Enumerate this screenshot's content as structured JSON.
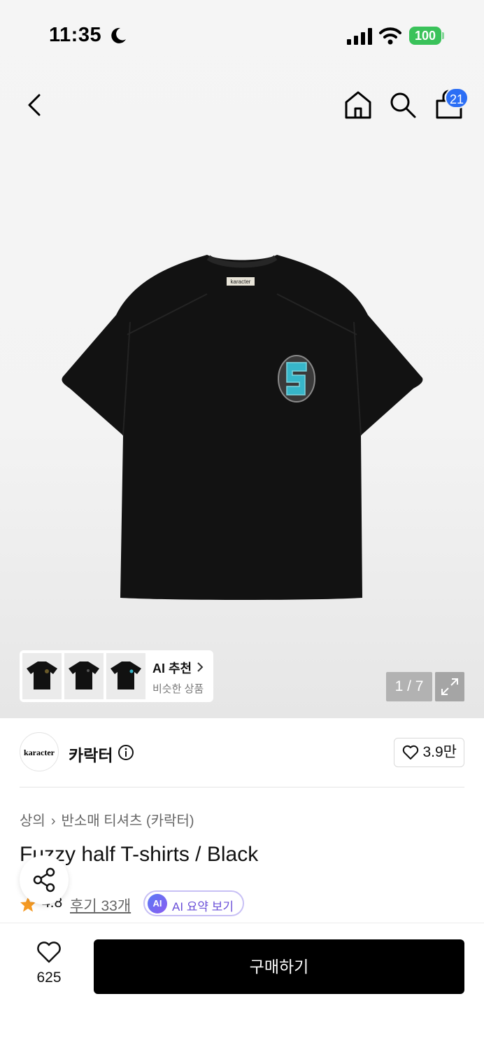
{
  "status_bar": {
    "time": "11:35",
    "battery": "100"
  },
  "header": {
    "cart_count": "21"
  },
  "gallery": {
    "ai_recommend_title": "AI 추천",
    "ai_recommend_subtitle": "비슷한 상품",
    "page_counter": "1 / 7",
    "shirt_tag_text": "karacter"
  },
  "brand": {
    "logo_text": "karacter",
    "name": "카락터",
    "likes": "3.9만"
  },
  "product": {
    "breadcrumb": [
      "상의",
      "반소매 티셔츠 (카락터)"
    ],
    "title": "Fuzzy half T-shirts / Black",
    "rating": "4.8",
    "reviews": "후기 33개",
    "ai_badge": "AI",
    "ai_summary": "AI 요약 보기"
  },
  "bottom_bar": {
    "favorite_count": "625",
    "buy_label": "구매하기"
  },
  "colors": {
    "accent_blue": "#2b6ef5",
    "battery_green": "#3ac25a",
    "rating_star": "#f59a23",
    "ai_purple": "#6a4fd8",
    "buy_button": "#000000"
  }
}
